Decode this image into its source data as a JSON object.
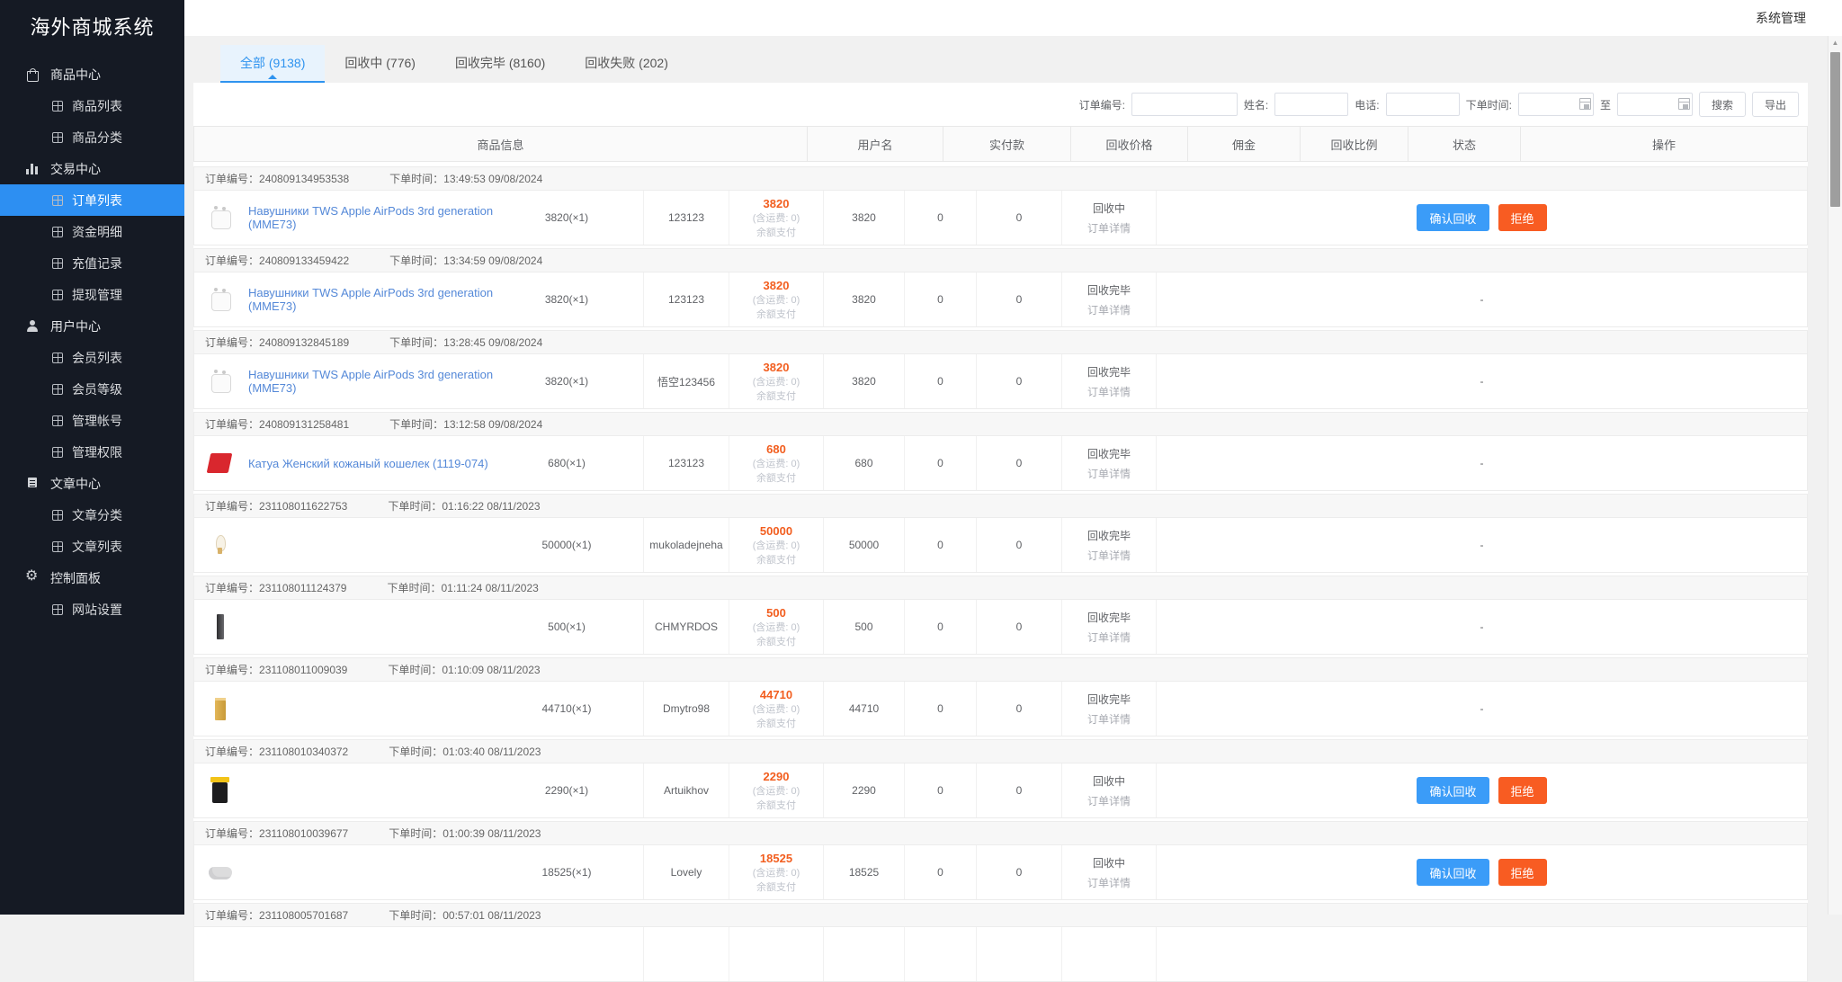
{
  "topbar": {
    "user_menu": "系统管理"
  },
  "sidebar": {
    "title": "海外商城系统",
    "active_item": "订单列表",
    "sections": [
      {
        "label": "商品中心",
        "icon": "shop-icon",
        "children": [
          "商品列表",
          "商品分类"
        ]
      },
      {
        "label": "交易中心",
        "icon": "chart-icon",
        "children": [
          "订单列表",
          "资金明细",
          "充值记录",
          "提现管理"
        ]
      },
      {
        "label": "用户中心",
        "icon": "user-icon",
        "children": [
          "会员列表",
          "会员等级",
          "管理帐号",
          "管理权限"
        ]
      },
      {
        "label": "文章中心",
        "icon": "article-icon",
        "children": [
          "文章分类",
          "文章列表"
        ]
      },
      {
        "label": "控制面板",
        "icon": "gear-icon",
        "children": [
          "网站设置"
        ]
      }
    ]
  },
  "tabs": [
    {
      "label": "全部 (9138)",
      "active": true
    },
    {
      "label": "回收中 (776)",
      "active": false
    },
    {
      "label": "回收完毕 (8160)",
      "active": false
    },
    {
      "label": "回收失败 (202)",
      "active": false
    }
  ],
  "filters": {
    "order_no_label": "订单编号:",
    "name_label": "姓名:",
    "phone_label": "电话:",
    "time_label": "下单时间:",
    "to_label": "至",
    "search_button": "搜索",
    "export_button": "导出",
    "order_no_value": "",
    "name_value": "",
    "phone_value": "",
    "time_from_value": "",
    "time_to_value": ""
  },
  "table": {
    "columns": [
      "商品信息",
      "用户名",
      "实付款",
      "回收价格",
      "佣金",
      "回收比例",
      "状态",
      "操作"
    ],
    "order_no_prefix": "订单编号：",
    "time_prefix": "下单时间：",
    "detail_link": "订单详情",
    "confirm_button": "确认回收",
    "reject_button": "拒绝",
    "no_action": "-"
  },
  "accent_colors": {
    "primary_blue": "#3b9cf8",
    "reject_orange": "#f85c22",
    "price_orange": "#f25e1f",
    "active_menu_blue": "#2d8ff2"
  },
  "orders": [
    {
      "no": "240809134953538",
      "time": "13:49:53 09/08/2024",
      "product_name": "Навушники TWS Apple AirPods 3rd generation (MME73)",
      "qty": "3820(×1)",
      "image": "airpods",
      "user": "123123",
      "paid": "3820",
      "paid_note": "(含运费: 0)",
      "pay_method": "余额支付",
      "price": "3820",
      "commission": "0",
      "ratio": "0",
      "status": "回收中",
      "op": "buttons"
    },
    {
      "no": "240809133459422",
      "time": "13:34:59 09/08/2024",
      "product_name": "Навушники TWS Apple AirPods 3rd generation (MME73)",
      "qty": "3820(×1)",
      "image": "airpods",
      "user": "123123",
      "paid": "3820",
      "paid_note": "(含运费: 0)",
      "pay_method": "余额支付",
      "price": "3820",
      "commission": "0",
      "ratio": "0",
      "status": "回收完毕",
      "op": "dash"
    },
    {
      "no": "240809132845189",
      "time": "13:28:45 09/08/2024",
      "product_name": "Навушники TWS Apple AirPods 3rd generation (MME73)",
      "qty": "3820(×1)",
      "image": "airpods",
      "user": "悟空123456",
      "paid": "3820",
      "paid_note": "(含运费: 0)",
      "pay_method": "余额支付",
      "price": "3820",
      "commission": "0",
      "ratio": "0",
      "status": "回收完毕",
      "op": "dash"
    },
    {
      "no": "240809131258481",
      "time": "13:12:58 09/08/2024",
      "product_name": "Катуа Женский кожаный кошелек (1119-074)",
      "qty": "680(×1)",
      "image": "wallet",
      "user": "123123",
      "paid": "680",
      "paid_note": "(含运费: 0)",
      "pay_method": "余额支付",
      "price": "680",
      "commission": "0",
      "ratio": "0",
      "status": "回收完毕",
      "op": "dash"
    },
    {
      "no": "231108011622753",
      "time": "01:16:22 08/11/2023",
      "product_name": "",
      "qty": "50000(×1)",
      "image": "necklace",
      "user": "mukoladejneha",
      "paid": "50000",
      "paid_note": "(含运费: 0)",
      "pay_method": "余额支付",
      "price": "50000",
      "commission": "0",
      "ratio": "0",
      "status": "回收完毕",
      "op": "dash"
    },
    {
      "no": "231108011124379",
      "time": "01:11:24 08/11/2023",
      "product_name": "",
      "qty": "500(×1)",
      "image": "phone",
      "user": "CHMYRDOS",
      "paid": "500",
      "paid_note": "(含运费: 0)",
      "pay_method": "余额支付",
      "price": "500",
      "commission": "0",
      "ratio": "0",
      "status": "回收完毕",
      "op": "dash"
    },
    {
      "no": "231108011009039",
      "time": "01:10:09 08/11/2023",
      "product_name": "",
      "qty": "44710(×1)",
      "image": "goldbar",
      "user": "Dmytro98",
      "paid": "44710",
      "paid_note": "(含运费: 0)",
      "pay_method": "余额支付",
      "price": "44710",
      "commission": "0",
      "ratio": "0",
      "status": "回收完毕",
      "op": "dash"
    },
    {
      "no": "231108010340372",
      "time": "01:03:40 08/11/2023",
      "product_name": "",
      "qty": "2290(×1)",
      "image": "jar",
      "user": "Artuikhov",
      "paid": "2290",
      "paid_note": "(含运费: 0)",
      "pay_method": "余额支付",
      "price": "2290",
      "commission": "0",
      "ratio": "0",
      "status": "回收中",
      "op": "buttons"
    },
    {
      "no": "231108010039677",
      "time": "01:00:39 08/11/2023",
      "product_name": "",
      "qty": "18525(×1)",
      "image": "controller",
      "user": "Lovely",
      "paid": "18525",
      "paid_note": "(含运费: 0)",
      "pay_method": "余额支付",
      "price": "18525",
      "commission": "0",
      "ratio": "0",
      "status": "回收中",
      "op": "buttons"
    },
    {
      "no": "231108005701687",
      "time": "00:57:01 08/11/2023",
      "product_name": "",
      "qty": "",
      "image": "",
      "user": "",
      "paid": "",
      "paid_note": "",
      "pay_method": "",
      "price": "",
      "commission": "",
      "ratio": "",
      "status": "",
      "op": "none"
    }
  ]
}
